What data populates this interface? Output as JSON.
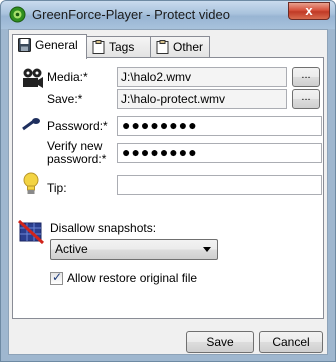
{
  "window": {
    "title": "GreenForce-Player - Protect video",
    "close_glyph": "x",
    "title_icon": "greenforce-logo-icon"
  },
  "tabs": [
    {
      "label": "General",
      "icon": "save-disk-icon",
      "active": true
    },
    {
      "label": "Tags",
      "icon": "clipboard-icon",
      "active": false
    },
    {
      "label": "Other",
      "icon": "clipboard-icon",
      "active": false
    }
  ],
  "form": {
    "media_label": "Media:*",
    "media_value": "J:\\halo2.wmv",
    "save_label": "Save:*",
    "save_value": "J:\\halo-protect.wmv",
    "browse_label": "...",
    "password_label": "Password:*",
    "password_value": "●●●●●●●●",
    "verify_label_line1": "Verify new",
    "verify_label_line2": "password:*",
    "verify_value": "●●●●●●●●",
    "tip_label": "Tip:",
    "tip_value": "",
    "disallow_label": "Disallow snapshots:",
    "disallow_value": "Active",
    "allow_restore_label": "Allow restore original file",
    "allow_restore_checked": true
  },
  "footer": {
    "save_button": "Save",
    "cancel_button": "Cancel"
  },
  "colors": {
    "accent": "#98b5d3",
    "close": "#c03a26",
    "tip_bulb": "#f3d443"
  }
}
